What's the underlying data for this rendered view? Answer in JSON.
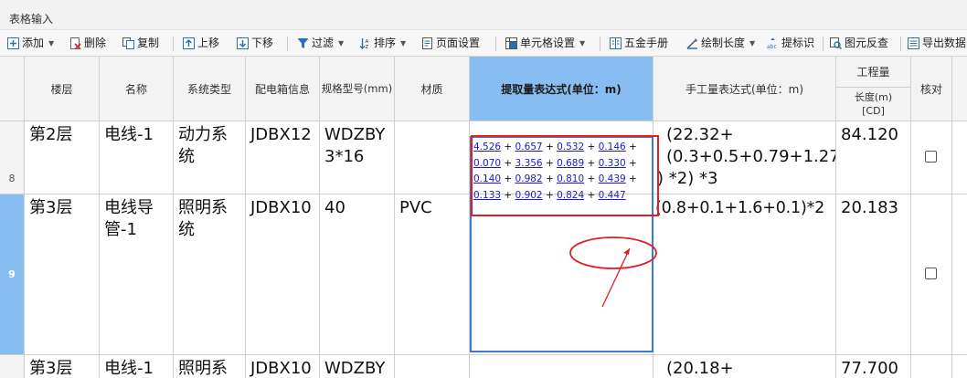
{
  "panel": {
    "title": "表格输入"
  },
  "toolbar": {
    "add": "添加",
    "delete": "删除",
    "copy": "复制",
    "move_up": "上移",
    "move_down": "下移",
    "filter": "过滤",
    "sort": "排序",
    "page_setup": "页面设置",
    "cell_setup": "单元格设置",
    "hardware_manual": "五金手册",
    "draw_length": "绘制长度",
    "extract_mark": "提标识",
    "element_reverse": "图元反查",
    "export": "导出数据"
  },
  "table": {
    "headers": {
      "floor": "楼层",
      "name": "名称",
      "system": "系统类型",
      "box": "配电箱信息",
      "spec": "规格型号(mm)",
      "material": "材质",
      "extract_expr": "提取量表达式(单位：m)",
      "manual_expr": "手工量表达式(单位：m)",
      "quantity_group": "工程量",
      "length": "长度(m)",
      "length_unit": "[CD]",
      "check": "核对"
    },
    "rows": [
      {
        "num": "8",
        "floor": "第2层",
        "name": "电线-1",
        "system": "动力系统",
        "box": "JDBX12",
        "spec": "WDZBY 3*16",
        "material": "",
        "manual_l1": "(22.32+",
        "manual_l2": "(0.3+0.5+0.79+1.27",
        "manual_l3": ")  *2)  *3",
        "length": "84.120",
        "checked": false
      },
      {
        "num": "9",
        "floor": "第3层",
        "name": "电线导管-1",
        "system": "照明系统",
        "box": "JDBX10",
        "spec": "40",
        "material": "PVC",
        "extract_values": [
          "4.526",
          "0.657",
          "0.532",
          "0.146",
          "0.070",
          "3.356",
          "0.689",
          "0.330",
          "0.140",
          "0.982",
          "0.810",
          "0.439",
          "0.133",
          "0.902",
          "0.824",
          "0.447"
        ],
        "manual": "(0.8+0.1+1.6+0.1)*2",
        "length": "20.183",
        "checked": false,
        "selected": true
      },
      {
        "num": "",
        "floor": "第3层",
        "name": "电线-1",
        "system": "照明系统",
        "box": "JDBX10",
        "spec": "WDZBY",
        "material": "",
        "manual": "(20.18+",
        "length": "77.700"
      }
    ]
  },
  "colors": {
    "selected_header": "#88bdf2",
    "edit_border": "#3a7bd5",
    "annotation": "#e02020",
    "link_value": "#1a1ad0"
  }
}
